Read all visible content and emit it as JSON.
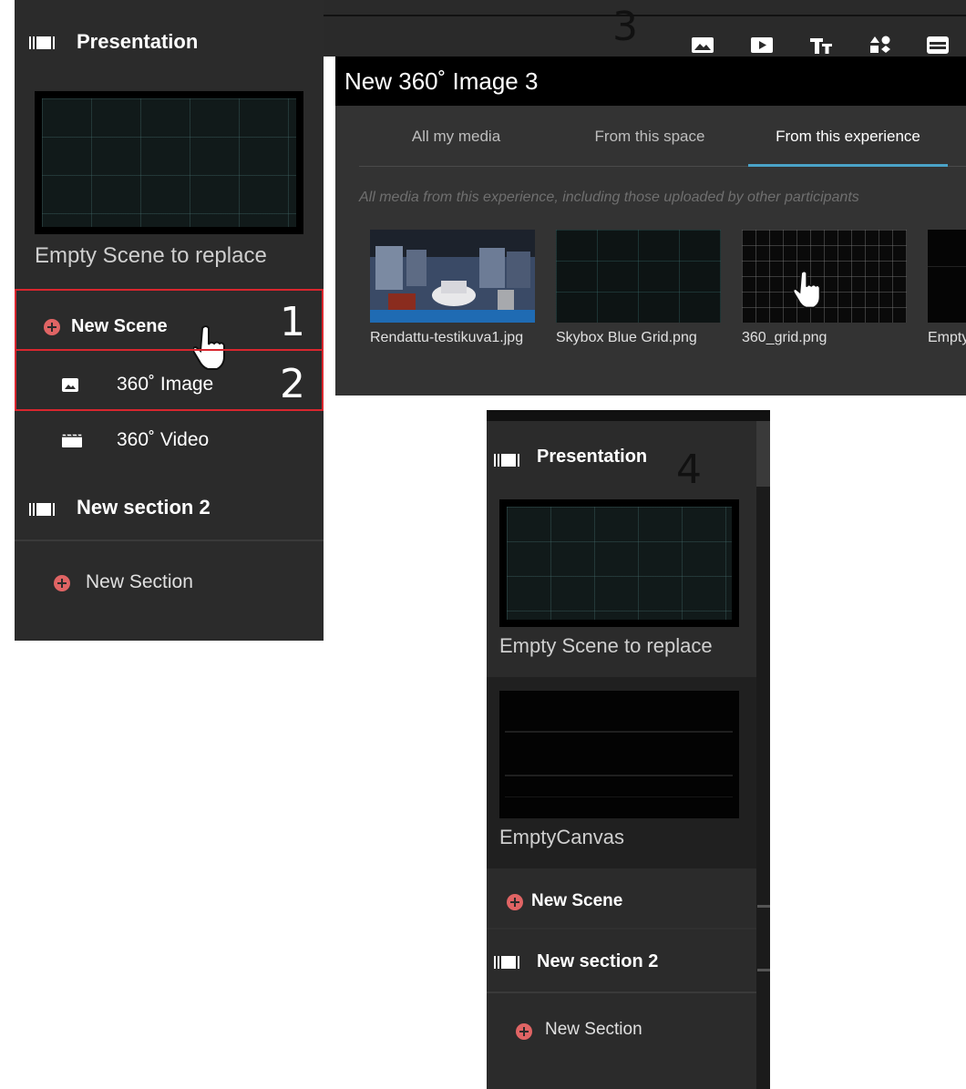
{
  "panel1": {
    "section_title": "Presentation",
    "scene_label": "Empty Scene to replace",
    "new_scene_label": "New Scene",
    "submenu": [
      "360˚ Image",
      "360˚ Video"
    ],
    "section2_title": "New section 2",
    "new_section_label": "New Section"
  },
  "step_numbers": [
    "1",
    "2",
    "3",
    "4"
  ],
  "dialog": {
    "title": "New 360˚ Image 3",
    "tabs": [
      "All my media",
      "From this space",
      "From this experience"
    ],
    "active_tab": "From this experience",
    "hint": "All media from this experience, including those uploaded by other participants",
    "media": [
      "Rendattu-testikuva1.jpg",
      "Skybox Blue Grid.png",
      "360_grid.png",
      "Empty"
    ]
  },
  "toolbar_icons": [
    "image-icon",
    "video-icon",
    "text-icon",
    "shapes-icon",
    "layout-icon"
  ],
  "panel4": {
    "section_title": "Presentation",
    "scenes": [
      "Empty Scene to replace",
      "EmptyCanvas"
    ],
    "new_scene_label": "New Scene",
    "section2_title": "New section 2",
    "new_section_label": "New Section"
  },
  "colors": {
    "accent_red": "#e06464",
    "highlight_box": "#d9262e",
    "tab_underline": "#4aa3c8",
    "panel_bg": "#2b2b2b"
  }
}
